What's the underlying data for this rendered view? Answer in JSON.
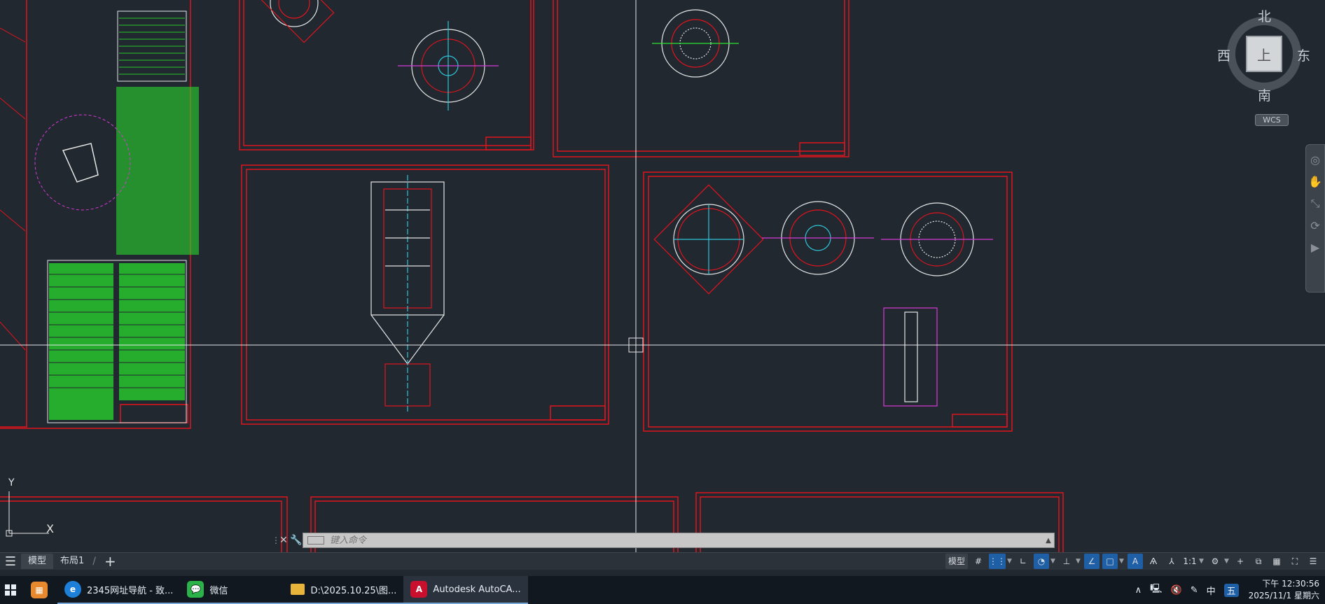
{
  "viewcube": {
    "north": "北",
    "south": "南",
    "east": "东",
    "west": "西",
    "face": "上",
    "wcs": "WCS"
  },
  "ucs": {
    "y_label": "Y",
    "x_label": "X"
  },
  "command_line": {
    "placeholder": "键入命令"
  },
  "layout_tabs": {
    "model": "模型",
    "layout1": "布局1",
    "add": "+"
  },
  "status_bar": {
    "model_label": "模型",
    "scale": "1:1"
  },
  "taskbar": {
    "apps": [
      {
        "label": "2345网址导航 - 致...",
        "icon": "edge-browser-icon",
        "color": "#1e7fd8"
      },
      {
        "label": "微信",
        "icon": "wechat-icon",
        "color": "#2bb34a"
      },
      {
        "label": "D:\\2025.10.25\\图...",
        "icon": "folder-icon",
        "color": "#e8b53a"
      },
      {
        "label": "Autodesk AutoCA...",
        "icon": "autocad-icon",
        "color": "#c8102e"
      }
    ],
    "tray_ime": "中",
    "clock_time": "下午 12:30:56",
    "clock_date": "2025/11/1 星期六"
  },
  "colors": {
    "canvas_bg": "#212830",
    "frame_red": "#e0141e",
    "geometry_green": "#29e62c",
    "geometry_white": "#e6e6e6",
    "geometry_magenta": "#d63ad6",
    "geometry_cyan": "#2fc6d9",
    "accent_blue": "#1f5fa6"
  }
}
